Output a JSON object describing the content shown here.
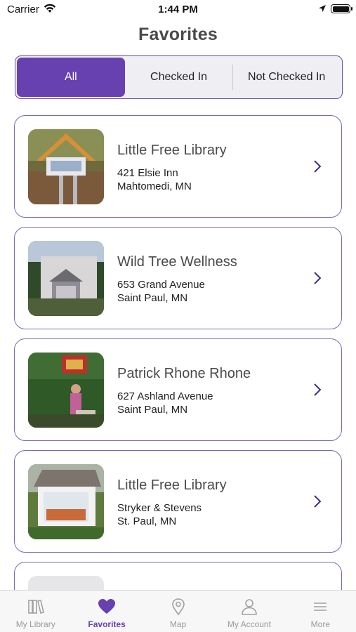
{
  "status_bar": {
    "carrier": "Carrier",
    "time": "1:44 PM"
  },
  "header": {
    "title": "Favorites"
  },
  "filter": {
    "segments": [
      "All",
      "Checked In",
      "Not Checked In"
    ],
    "selected": "All"
  },
  "favorites": [
    {
      "name": "Little Free Library",
      "line1": "421 Elsie Inn",
      "line2": "Mahtomedi, MN"
    },
    {
      "name": "Wild Tree Wellness",
      "line1": "653 Grand Avenue",
      "line2": "Saint Paul, MN"
    },
    {
      "name": "Patrick Rhone Rhone",
      "line1": "627 Ashland Avenue",
      "line2": "Saint Paul, MN"
    },
    {
      "name": "Little Free Library",
      "line1": "Stryker & Stevens",
      "line2": "St. Paul, MN"
    }
  ],
  "tab_bar": {
    "tabs": [
      {
        "label": "My Library",
        "icon": "books-icon"
      },
      {
        "label": "Favorites",
        "icon": "heart-icon"
      },
      {
        "label": "Map",
        "icon": "map-pin-icon"
      },
      {
        "label": "My Account",
        "icon": "person-icon"
      },
      {
        "label": "More",
        "icon": "menu-icon"
      }
    ],
    "active": "Favorites"
  },
  "colors": {
    "accent": "#6741b0",
    "card_border": "#7b67bf"
  }
}
